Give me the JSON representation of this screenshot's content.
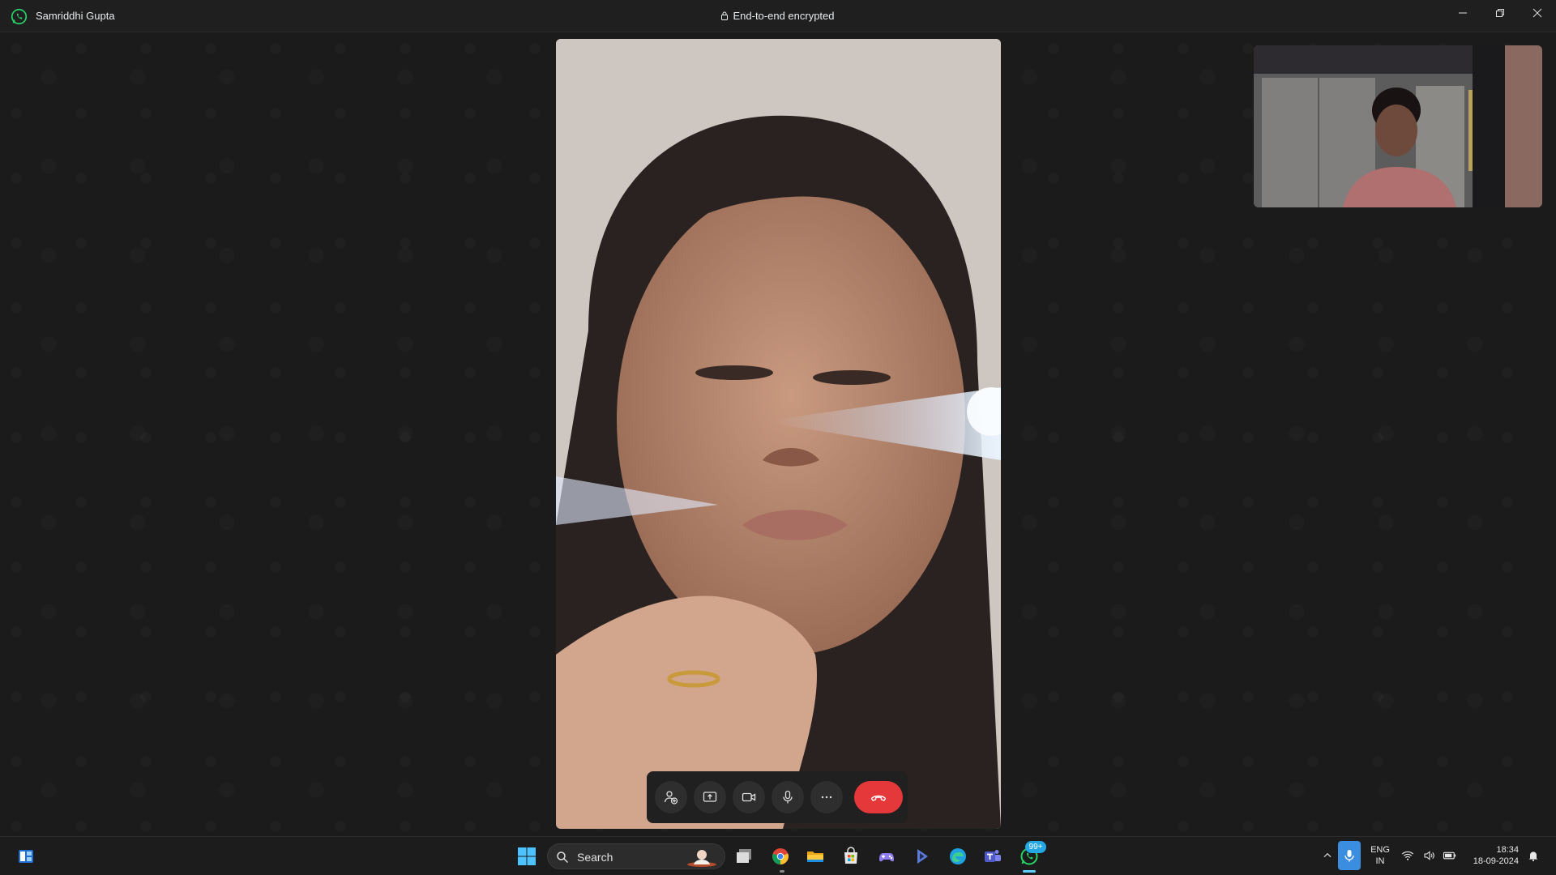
{
  "titlebar": {
    "contact_name": "Samriddhi Gupta",
    "encryption_status": "End-to-end encrypted",
    "app_icon": "whatsapp-icon"
  },
  "window_controls": [
    "minimize-icon",
    "restore-icon",
    "close-icon"
  ],
  "call": {
    "remote_video": "remote-participant-video",
    "self_view": "self-camera-preview",
    "controls": [
      {
        "name": "add-participant-button",
        "icon": "add-person-icon"
      },
      {
        "name": "share-screen-button",
        "icon": "share-screen-icon"
      },
      {
        "name": "camera-toggle-button",
        "icon": "video-camera-icon"
      },
      {
        "name": "microphone-toggle-button",
        "icon": "microphone-icon"
      },
      {
        "name": "more-options-button",
        "icon": "more-horizontal-icon"
      },
      {
        "name": "end-call-button",
        "icon": "hang-up-icon",
        "color": "#e5383b"
      }
    ]
  },
  "taskbar": {
    "search_placeholder": "Search",
    "whatsapp_badge": "99+",
    "pinned": [
      "start-icon",
      "task-view-icon",
      "chrome-icon",
      "file-explorer-icon",
      "microsoft-store-icon",
      "game-controller-icon",
      "copilot-icon",
      "edge-icon",
      "teams-icon",
      "whatsapp-icon"
    ],
    "widgets_icon": "widgets-icon",
    "accent": "#60cdff"
  },
  "tray": {
    "language_line1": "ENG",
    "language_line2": "IN",
    "time": "18:34",
    "date": "18-09-2024",
    "icons": [
      "chevron-up-icon",
      "microphone-active-icon",
      "wifi-icon",
      "volume-icon",
      "battery-icon",
      "notification-bell-icon"
    ]
  }
}
